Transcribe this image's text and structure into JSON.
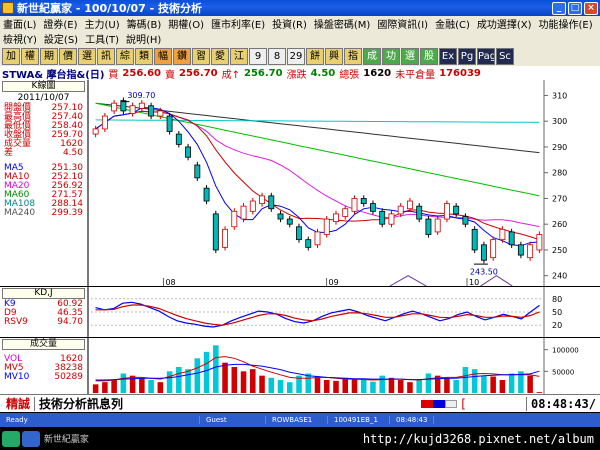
{
  "window": {
    "title": "新世紀贏家 - 100/10/07 - 技術分析"
  },
  "menu": {
    "row1": [
      "畫面(L)",
      "證券(E)",
      "主力(U)",
      "籌碼(B)",
      "期權(O)",
      "匯市利率(E)",
      "投資(R)",
      "操盤密碼(M)",
      "國際資訊(I)",
      "金融(C)",
      "成功選擇(X)",
      "功能操作(E)"
    ],
    "row2": [
      "檢視(Y)",
      "設定(S)",
      "工具(T)",
      "說明(H)"
    ]
  },
  "toolbar": [
    "加",
    "權",
    "期",
    "價",
    "選",
    "訊",
    "綜",
    "類",
    "幅",
    "鑽",
    "習",
    "愛",
    "江",
    "9",
    "8",
    "29",
    "餅",
    "興",
    "指",
    "成",
    "功",
    "選",
    "股",
    "Ex",
    "Pg",
    "Page",
    "Sc"
  ],
  "quote": {
    "symbol": "STWA& 摩台指&(日)",
    "buy_label": "買",
    "buy": "256.60",
    "sell_label": "賣",
    "sell": "256.70",
    "deal_label": "成↑",
    "deal": "256.70",
    "change_label": "漲跌",
    "change": "4.50",
    "volume_label": "總張",
    "volume": "1620",
    "oi_label": "未平倉量",
    "oi": "176039"
  },
  "kpanel": {
    "title": "K線圖",
    "date": "2011/10/07",
    "rows": [
      {
        "label": "開盤價",
        "value": "257.10",
        "lc": "lbl-red",
        "vc": "val"
      },
      {
        "label": "最高價",
        "value": "257.40",
        "lc": "lbl-red",
        "vc": "val"
      },
      {
        "label": "最低價",
        "value": "258.40",
        "lc": "lbl-red",
        "vc": "val"
      },
      {
        "label": "收盤價",
        "value": "259.70",
        "lc": "lbl-red",
        "vc": "val"
      },
      {
        "label": "成交量",
        "value": "1620",
        "lc": "lbl-red",
        "vc": "val"
      },
      {
        "label": "差",
        "value": "4.50",
        "lc": "lbl-red",
        "vc": "val"
      }
    ],
    "ma": [
      {
        "label": "MA5",
        "value": "251.30",
        "lc": "lbl-blue"
      },
      {
        "label": "MA10",
        "value": "252.10",
        "lc": "lbl-red"
      },
      {
        "label": "MA20",
        "value": "256.92",
        "lc": "lbl-mag"
      },
      {
        "label": "MA60",
        "value": "271.57",
        "lc": "lbl-grn"
      },
      {
        "label": "MA108",
        "value": "288.14",
        "lc": "lbl-cyan"
      },
      {
        "label": "MA240",
        "value": "299.39",
        "lc": "lbl-dark"
      }
    ]
  },
  "kdpanel": {
    "title": "KD,J",
    "rows": [
      {
        "label": "K9",
        "value": "60.92",
        "lc": "lbl-blue"
      },
      {
        "label": "D9",
        "value": "46.35",
        "lc": "lbl-red"
      },
      {
        "label": "RSV9",
        "value": "94.70",
        "lc": "lbl-red"
      }
    ]
  },
  "volpanel": {
    "title": "成交量",
    "rows": [
      {
        "label": "VOL",
        "value": "1620",
        "lc": "lbl-mag"
      },
      {
        "label": "MV5",
        "value": "38238",
        "lc": "lbl-red"
      },
      {
        "label": "MV10",
        "value": "50289",
        "lc": "lbl-blue"
      }
    ]
  },
  "chart_data": [
    {
      "type": "candlestick",
      "title": "",
      "y_ticks": [
        240,
        250,
        260,
        270,
        280,
        290,
        300,
        310
      ],
      "ylim": [
        236,
        316
      ],
      "x_labels": [
        "08",
        "09",
        "10"
      ],
      "annotations": [
        {
          "text": "309.70"
        },
        {
          "text": "243.50"
        }
      ],
      "candles": [
        {
          "o": 295,
          "c": 297
        },
        {
          "o": 297,
          "c": 302
        },
        {
          "o": 304,
          "c": 307
        },
        {
          "o": 308,
          "c": 304
        },
        {
          "o": 303,
          "c": 306
        },
        {
          "o": 305,
          "c": 307
        },
        {
          "o": 306,
          "c": 302
        },
        {
          "o": 302,
          "c": 304
        },
        {
          "o": 302,
          "c": 296
        },
        {
          "o": 295,
          "c": 291
        },
        {
          "o": 290,
          "c": 286
        },
        {
          "o": 283,
          "c": 278
        },
        {
          "o": 274,
          "c": 269
        },
        {
          "o": 264,
          "c": 250
        },
        {
          "o": 251,
          "c": 258
        },
        {
          "o": 259,
          "c": 265
        },
        {
          "o": 262,
          "c": 267
        },
        {
          "o": 265,
          "c": 269
        },
        {
          "o": 268,
          "c": 271
        },
        {
          "o": 271,
          "c": 266
        },
        {
          "o": 264,
          "c": 262
        },
        {
          "o": 262,
          "c": 260
        },
        {
          "o": 259,
          "c": 254
        },
        {
          "o": 254,
          "c": 251
        },
        {
          "o": 252,
          "c": 257
        },
        {
          "o": 256,
          "c": 262
        },
        {
          "o": 261,
          "c": 264
        },
        {
          "o": 263,
          "c": 266
        },
        {
          "o": 265,
          "c": 270
        },
        {
          "o": 270,
          "c": 268
        },
        {
          "o": 268,
          "c": 265
        },
        {
          "o": 265,
          "c": 260
        },
        {
          "o": 260,
          "c": 264
        },
        {
          "o": 264,
          "c": 267
        },
        {
          "o": 266,
          "c": 269
        },
        {
          "o": 267,
          "c": 262
        },
        {
          "o": 262,
          "c": 256
        },
        {
          "o": 257,
          "c": 262
        },
        {
          "o": 262,
          "c": 268
        },
        {
          "o": 267,
          "c": 264
        },
        {
          "o": 263,
          "c": 260
        },
        {
          "o": 258,
          "c": 250
        },
        {
          "o": 252,
          "c": 246
        },
        {
          "o": 247,
          "c": 254
        },
        {
          "o": 254,
          "c": 258
        },
        {
          "o": 257,
          "c": 252
        },
        {
          "o": 252,
          "c": 248
        },
        {
          "o": 247,
          "c": 252
        },
        {
          "o": 250,
          "c": 256
        }
      ]
    },
    {
      "type": "line",
      "title": "",
      "y_ticks": [
        20,
        50,
        80
      ],
      "ylim": [
        0,
        100
      ],
      "series": [
        {
          "values": [
            60,
            55,
            58,
            70,
            72,
            68,
            60,
            52,
            40,
            30,
            25,
            22,
            18,
            16,
            20,
            30,
            38,
            45,
            52,
            50,
            45,
            35,
            28,
            25,
            30,
            40,
            48,
            52,
            56,
            50,
            42,
            36,
            30,
            38,
            46,
            52,
            46,
            38,
            30,
            35,
            44,
            50,
            40,
            32,
            38,
            45,
            40,
            34,
            50,
            65
          ]
        },
        {
          "values": [
            55,
            55,
            56,
            62,
            66,
            66,
            63,
            58,
            50,
            42,
            35,
            30,
            25,
            22,
            20,
            24,
            30,
            36,
            42,
            46,
            46,
            42,
            36,
            32,
            30,
            34,
            40,
            44,
            48,
            48,
            46,
            42,
            38,
            38,
            42,
            46,
            46,
            42,
            38,
            37,
            40,
            44,
            42,
            38,
            38,
            41,
            40,
            38,
            42,
            50
          ]
        }
      ]
    },
    {
      "type": "bar",
      "title": "",
      "y_ticks": [
        0,
        50000,
        100000
      ],
      "ylim": [
        0,
        120000
      ],
      "values": [
        20000,
        25000,
        30000,
        45000,
        40000,
        35000,
        30000,
        25000,
        50000,
        60000,
        55000,
        80000,
        95000,
        110000,
        70000,
        60000,
        50000,
        55000,
        40000,
        35000,
        30000,
        25000,
        40000,
        45000,
        38000,
        30000,
        28000,
        35000,
        32000,
        30000,
        26000,
        40000,
        35000,
        30000,
        25000,
        30000,
        45000,
        40000,
        35000,
        30000,
        60000,
        55000,
        40000,
        38000,
        30000,
        45000,
        50000,
        40000,
        2000
      ],
      "series": [
        {
          "values": [
            28000,
            28000,
            30000,
            34000,
            36000,
            36000,
            34000,
            32000,
            38000,
            45000,
            50000,
            58000,
            68000,
            82000,
            84000,
            80000,
            72000,
            62000,
            55000,
            48000,
            42000,
            36000,
            34000,
            34000,
            36000,
            36000,
            34000,
            32000,
            32000,
            31000,
            30000,
            31000,
            32000,
            32000,
            31000,
            30000,
            33000,
            35000,
            36000,
            36000,
            40000,
            44000,
            45000,
            44000,
            42000,
            42000,
            42000,
            42000,
            38238
          ]
        },
        {
          "values": [
            30000,
            30000,
            31000,
            32000,
            33000,
            34000,
            34000,
            34000,
            35000,
            38000,
            42000,
            46000,
            52000,
            60000,
            64000,
            66000,
            66000,
            64000,
            62000,
            58000,
            54000,
            48000,
            44000,
            40000,
            38000,
            36000,
            35000,
            34000,
            33000,
            33000,
            32000,
            32000,
            32000,
            32000,
            31000,
            31000,
            32000,
            33000,
            34000,
            34000,
            36000,
            38000,
            40000,
            41000,
            42000,
            42000,
            43000,
            44000,
            50289
          ]
        }
      ]
    }
  ],
  "message_bar": {
    "tag": "精誠",
    "text": "技術分析訊息列",
    "bracket": "[",
    "time": "08:48:43/"
  },
  "status": [
    "Ready",
    "Guest",
    "ROWBASE1",
    "100491EB_1",
    "08:48:43"
  ],
  "taskbar": {
    "caption": "新世紀贏家",
    "watermark": "http://kujd3268.pixnet.net/album"
  },
  "colors": {
    "up": "#d00000",
    "down": "#00b8b8",
    "ma5": "#0000ff",
    "ma10": "#d00000",
    "ma20": "#e020e0",
    "ma60": "#00c000",
    "ma108": "#00c8c8",
    "ma240": "#303030"
  }
}
